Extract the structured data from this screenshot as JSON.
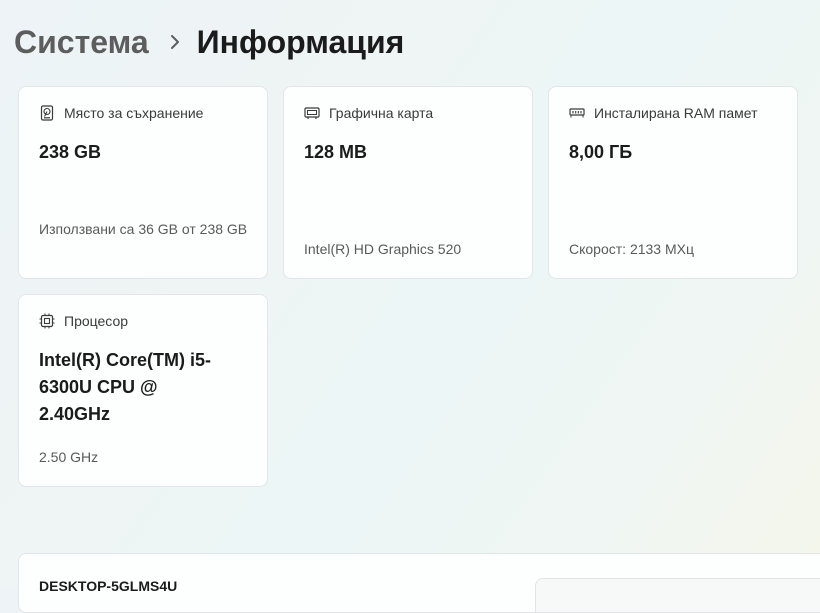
{
  "breadcrumb": {
    "parent": "Система",
    "current": "Информация"
  },
  "cards": {
    "storage": {
      "icon": "hard-drive-icon",
      "label": "Място за съхранение",
      "value": "238 GB",
      "detail": "Използвани са 36 GB от 238 GB"
    },
    "graphics": {
      "icon": "graphics-card-icon",
      "label": "Графична карта",
      "value": "128 MB",
      "detail": "Intel(R) HD Graphics 520"
    },
    "ram": {
      "icon": "memory-icon",
      "label": "Инсталирана RAM памет",
      "value": "8,00 ГБ",
      "detail": "Скорост: 2133 МХц"
    },
    "processor": {
      "icon": "processor-icon",
      "label": "Процесор",
      "value": "Intel(R) Core(TM) i5-6300U CPU @ 2.40GHz",
      "detail": "2.50 GHz"
    }
  },
  "device": {
    "name": "DESKTOP-5GLMS4U"
  }
}
